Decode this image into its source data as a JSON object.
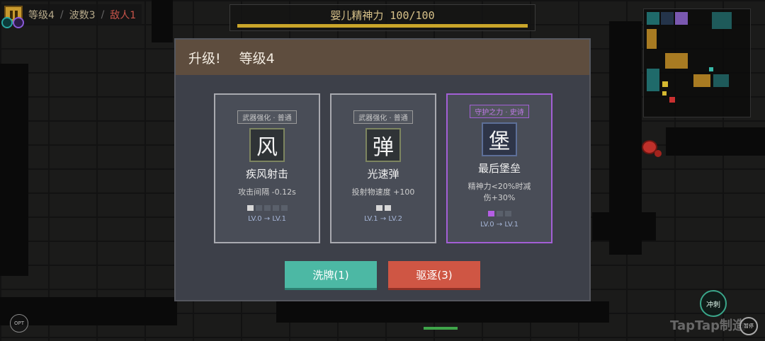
{
  "hud": {
    "level": "等级4",
    "sep1": "/",
    "wave": "波数3",
    "sep2": "/",
    "enemies": "敌人1",
    "spirit_label": "婴儿精神力 100/100",
    "spirit_fraction": 1.0
  },
  "dialog": {
    "title_prefix": "升级!",
    "title_level": "等级4",
    "cards": [
      {
        "tag": "武器强化 · 普通",
        "glyph": "风",
        "name": "疾风射击",
        "desc": "攻击间隔 -0.12s",
        "level": "LV.0 → LV.1",
        "pips_filled": 1,
        "pips_total": 5,
        "rarity": "common"
      },
      {
        "tag": "武器强化 · 普通",
        "glyph": "弹",
        "name": "光速弹",
        "desc": "投射物速度 +100",
        "level": "LV.1 → LV.2",
        "pips_filled": 2,
        "pips_total": 2,
        "rarity": "common"
      },
      {
        "tag": "守护之力 · 史诗",
        "glyph": "堡",
        "name": "最后堡垒",
        "desc": "精神力<20%时减伤+30%",
        "level": "LV.0 → LV.1",
        "pips_filled": 1,
        "pips_total": 3,
        "rarity": "epic"
      }
    ],
    "shuffle_label": "洗牌(1)",
    "banish_label": "驱逐(3)"
  },
  "controls": {
    "dash_label": "冲刺",
    "pause_label": "暂停",
    "left_label": "OPT"
  },
  "watermark": "TapTap制造",
  "colors": {
    "accent_teal": "#4cb8a4",
    "accent_red": "#cf5644",
    "epic_purple": "#a35fd6",
    "header_brown": "#5e4d3e",
    "spirit_gold": "#c9a52a"
  }
}
